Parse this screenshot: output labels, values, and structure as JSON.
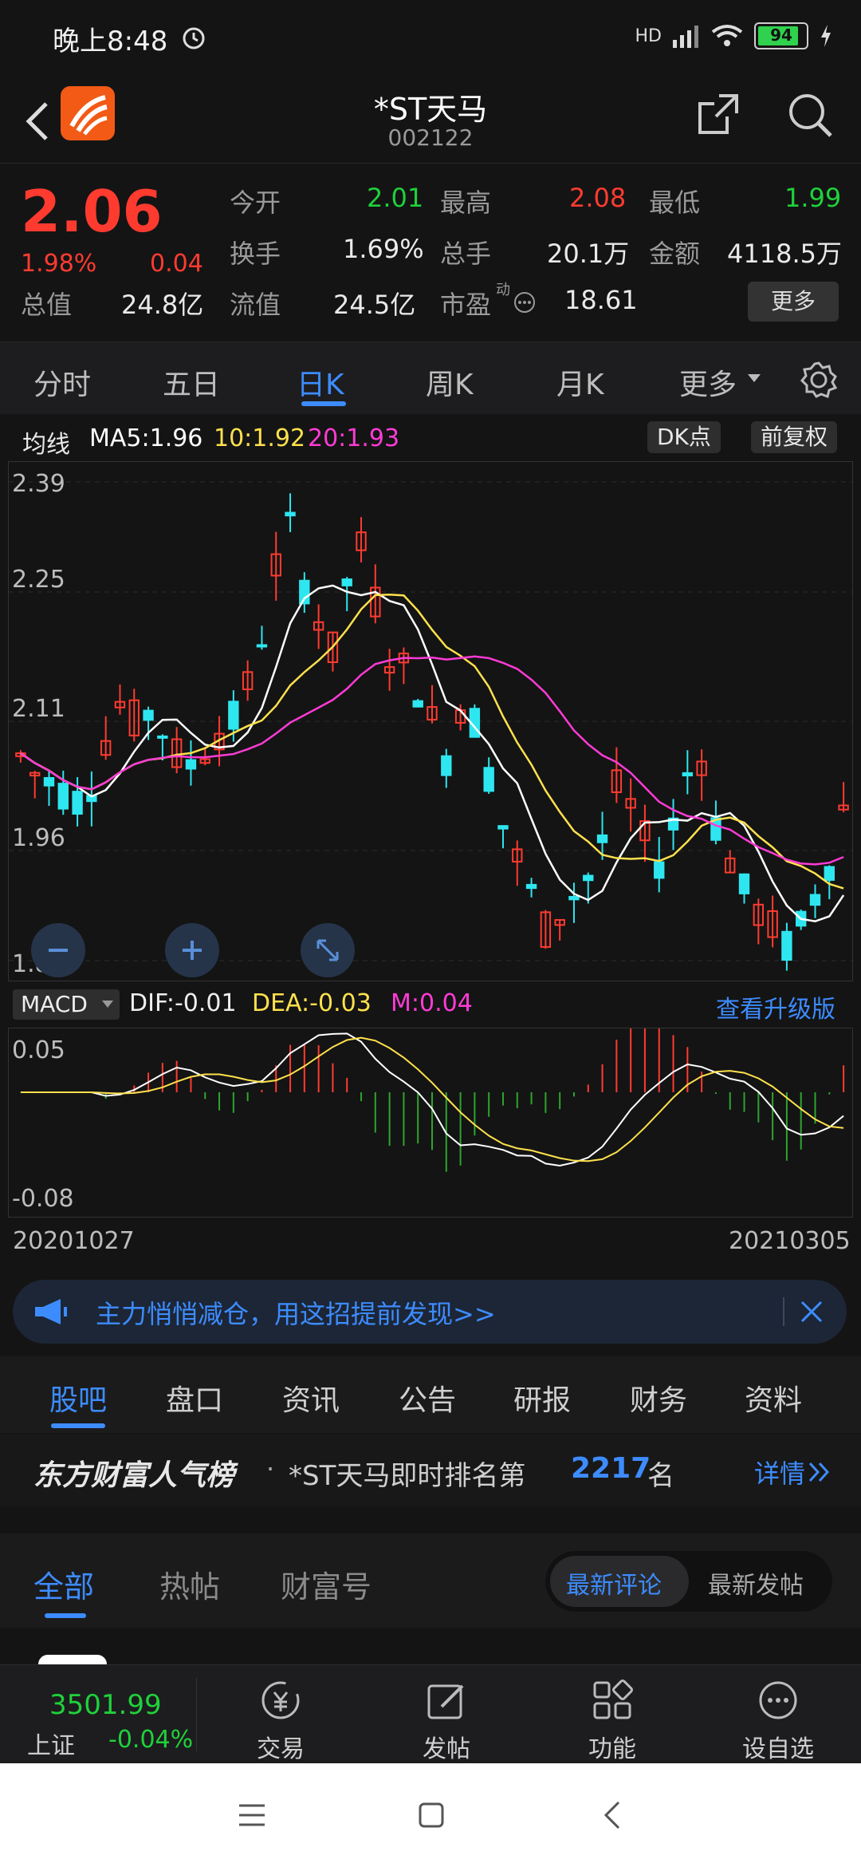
{
  "status": {
    "time": "晚上8:48",
    "network": "HD",
    "battery": "94"
  },
  "header": {
    "title": "*ST天马",
    "code": "002122"
  },
  "quote": {
    "price": "2.06",
    "pct": "1.98%",
    "change": "0.04",
    "open_label": "今开",
    "open": "2.01",
    "high_label": "最高",
    "high": "2.08",
    "low_label": "最低",
    "low": "1.99",
    "turnover_label": "换手",
    "turnover": "1.69%",
    "volume_label": "总手",
    "volume": "20.1万",
    "amount_label": "金额",
    "amount": "4118.5万",
    "totalcap_label": "总值",
    "totalcap": "24.8亿",
    "floatcap_label": "流值",
    "floatcap": "24.5亿",
    "pe_label": "市盈",
    "pe_sup": "动",
    "pe": "18.61",
    "more": "更多"
  },
  "tabs": [
    "分时",
    "五日",
    "日K",
    "周K",
    "月K",
    "更多"
  ],
  "active_tab": "日K",
  "chart": {
    "ma_label": "均线",
    "ma5": "MA5:1.96",
    "ma10": "10:1.92",
    "ma20": "20:1.93",
    "dk_button": "DK点",
    "adjust_button": "前复权",
    "y_ticks": [
      "2.39",
      "2.25",
      "2.11",
      "1.96",
      "1.82"
    ],
    "macd_select": "MACD",
    "dif": "DIF:-0.01",
    "dea": "DEA:-0.03",
    "m": "M:0.04",
    "upgrade_link": "查看升级版",
    "macd_ticks": [
      "0.05",
      "-0.08"
    ],
    "start_date": "20201027",
    "end_date": "20210305",
    "colors": {
      "up": "#ff3b30",
      "down": "#2ee6f0",
      "ma5": "#ffffff",
      "ma10": "#ffe14d",
      "ma20": "#ff3bd6"
    }
  },
  "banner": {
    "text": "主力悄悄减仓，用这招提前发现>>"
  },
  "news_tabs": [
    "股吧",
    "盘口",
    "资讯",
    "公告",
    "研报",
    "财务",
    "资料"
  ],
  "active_news_tab": "股吧",
  "rank": {
    "brand": "东方财富人气榜",
    "dot": "·",
    "prefix": "*ST天马即时排名第",
    "number": "2217",
    "suffix": "名",
    "detail": "详情"
  },
  "sub_tabs": [
    "全部",
    "热帖",
    "财富号"
  ],
  "active_sub_tab": "全部",
  "sort_options": [
    "最新评论",
    "最新发帖"
  ],
  "bottom": {
    "index_value": "3501.99",
    "index_name": "上证",
    "index_change": "-0.04%",
    "nav": [
      "交易",
      "发帖",
      "功能",
      "设自选"
    ]
  }
}
